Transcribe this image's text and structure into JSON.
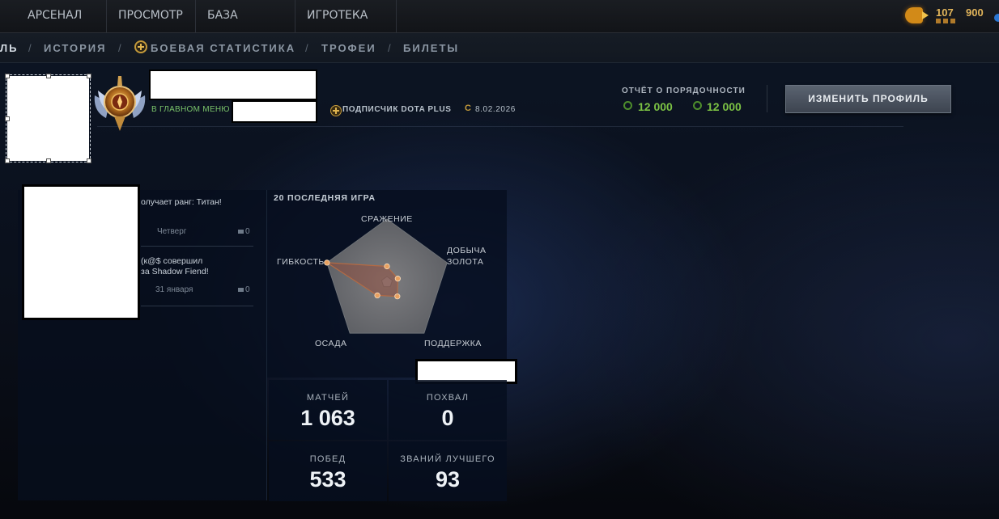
{
  "top_nav": {
    "tabs": [
      "АРСЕНАЛ",
      "ПРОСМОТР",
      "БАЗА ЗНАНИЙ",
      "ИГРОТЕКА"
    ],
    "currency": {
      "icon": "shards-icon",
      "value_1": "107",
      "value_2": "900"
    }
  },
  "sub_nav": {
    "items": [
      "ЛЬ",
      "ИСТОРИЯ",
      "БОЕВАЯ СТАТИСТИКА",
      "ТРОФЕИ",
      "БИЛЕТЫ"
    ],
    "separator": "/"
  },
  "profile": {
    "status": "В ГЛАВНОМ МЕНЮ",
    "subscription": "ПОДПИСЧИК DOTA PLUS",
    "date_icon": "C",
    "date": "8.02.2026",
    "conduct_title": "ОТЧЁТ О ПОРЯДОЧНОСТИ",
    "conduct_values": [
      "12 000",
      "12 000"
    ],
    "edit_button": "ИЗМЕНИТЬ ПРОФИЛЬ"
  },
  "feed": {
    "items": [
      {
        "text": "олучает ранг: Титан!",
        "day": "Четверг",
        "comments": "0"
      },
      {
        "text_line1": "(к@$ совершил",
        "text_line2": "за Shadow Fiend!",
        "day": "31 января",
        "comments": "0"
      }
    ]
  },
  "radar": {
    "title": "20 ПОСЛЕДНЯЯ ИГРА",
    "axes": [
      "СРАЖЕНИЕ",
      "ДОБЫЧА ЗОЛОТА",
      "ПОДДЕРЖКА",
      "ОСАДА",
      "ГИБКОСТЬ"
    ],
    "axis_line1": "ДОБЫЧА",
    "axis_line2": "ЗОЛОТА",
    "values": [
      0.25,
      0.18,
      0.28,
      0.26,
      1.0
    ],
    "accent": "#e8a060"
  },
  "stats": [
    {
      "label": "МАТЧЕЙ",
      "value": "1 063"
    },
    {
      "label": "ПОХВАЛ",
      "value": "0"
    },
    {
      "label": "ПОБЕД",
      "value": "533"
    },
    {
      "label": "ЗВАНИЙ ЛУЧШЕГО",
      "value": "93"
    }
  ]
}
